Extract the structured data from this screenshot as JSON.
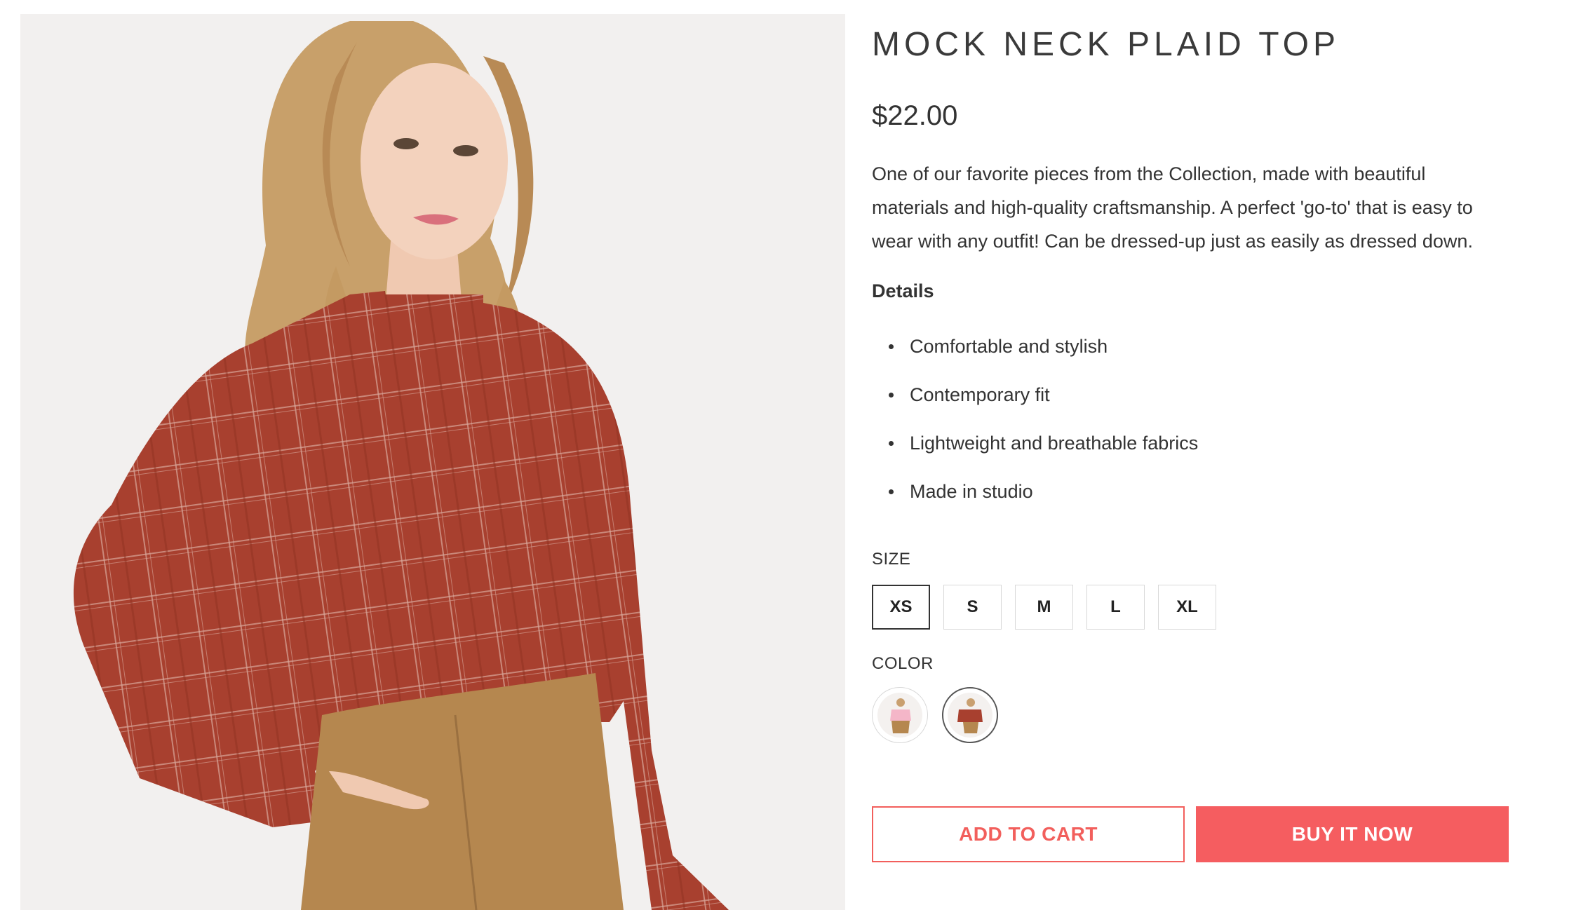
{
  "product": {
    "title": "MOCK NECK PLAID TOP",
    "price": "$22.00",
    "description": "One of our favorite pieces from the Collection, made with beautiful materials and high-quality craftsmanship. A perfect 'go-to' that is easy to wear with any outfit! Can be dressed-up just as easily as dressed down.",
    "details_heading": "Details",
    "details": [
      "Comfortable and stylish",
      "Contemporary fit",
      "Lightweight and breathable fabrics",
      "Made in studio"
    ]
  },
  "options": {
    "size_label": "SIZE",
    "sizes": [
      "XS",
      "S",
      "M",
      "L",
      "XL"
    ],
    "selected_size": "XS",
    "color_label": "COLOR",
    "colors": [
      {
        "icon": "pink-top-swatch-icon"
      },
      {
        "icon": "rust-plaid-top-swatch-icon"
      }
    ],
    "selected_color_index": 1
  },
  "actions": {
    "add_to_cart": "ADD TO CART",
    "buy_now": "BUY IT NOW"
  },
  "colors": {
    "accent": "#f55d60",
    "plaid": "#a8402f",
    "skirt": "#b5874f",
    "image_bg": "#f2f0ef"
  }
}
